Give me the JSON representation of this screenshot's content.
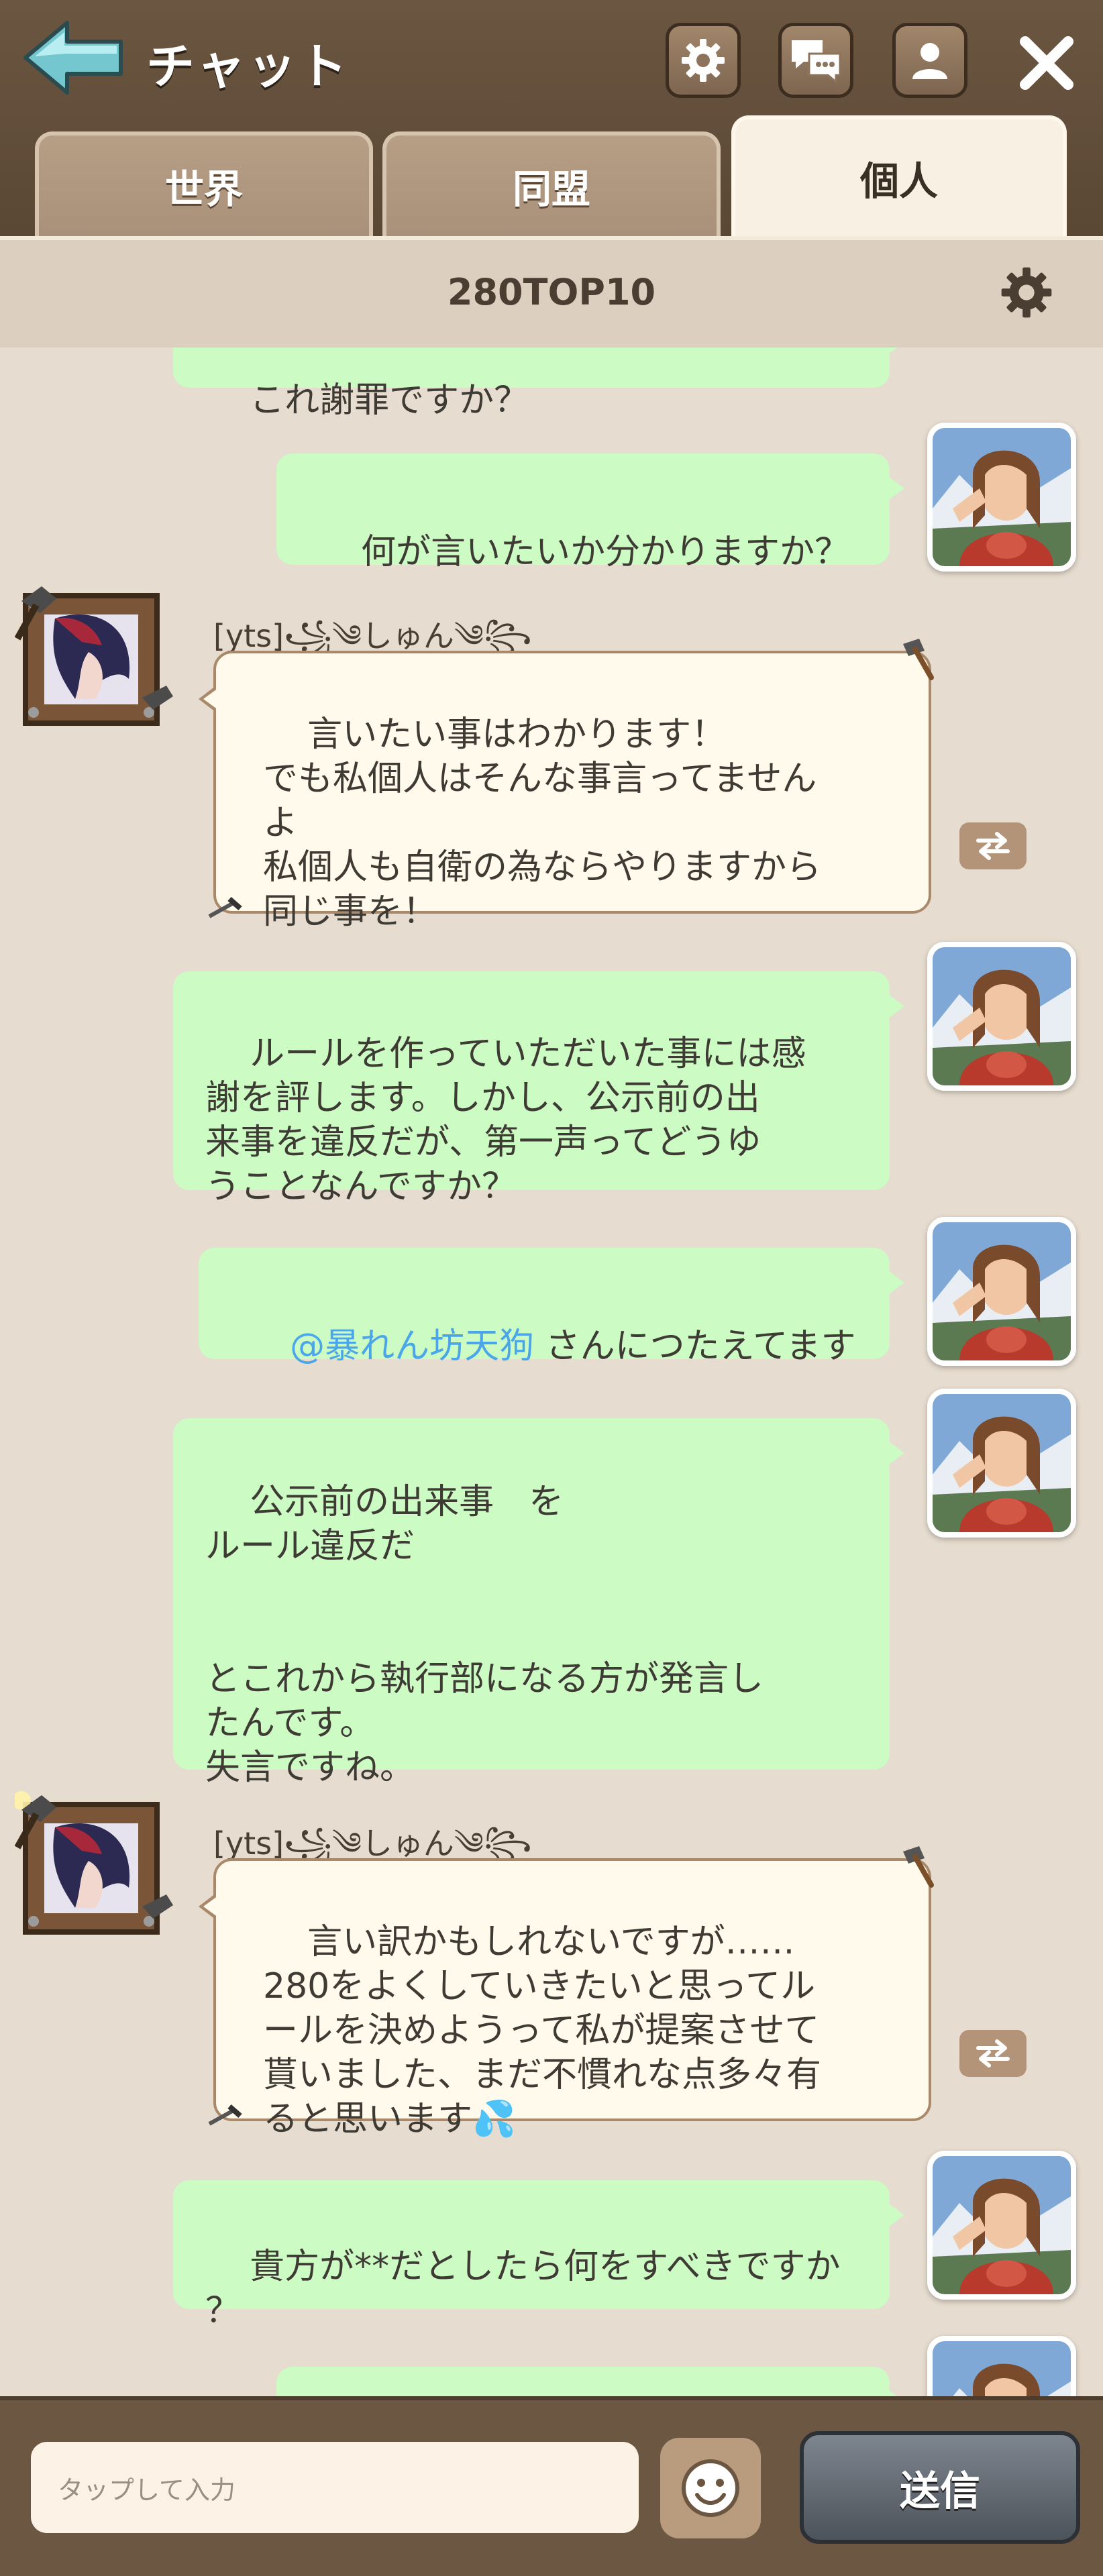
{
  "header": {
    "title": "チャット",
    "back_icon": "back-arrow-icon",
    "icons": [
      "gear-icon",
      "chat-bubbles-icon",
      "profile-icon",
      "close-icon"
    ]
  },
  "tabs": [
    {
      "label": "世界",
      "active": false
    },
    {
      "label": "同盟",
      "active": false
    },
    {
      "label": "個人",
      "active": true
    }
  ],
  "room": {
    "name": "280TOP10"
  },
  "messages": {
    "m0": "これ謝罪ですか？",
    "m1": "何が言いたいか分かりますか？",
    "m2_sender": "[yts]꧁༄しゅん༄꧂",
    "m2": "言いたい事はわかります！\nでも私個人はそんな事言ってません\nよ\n私個人も自衛の為ならやりますから\n同じ事を！",
    "m3": "ルールを作っていただいた事には感\n謝を評します。しかし、公示前の出\n来事を違反だが、第一声ってどうゆ\nうことなんですか？",
    "m4_mention": "@暴れん坊天狗",
    "m4_text": " さんにつたえてます",
    "m5": "公示前の出来事　を\nルール違反だ\n\n\nとこれから執行部になる方が発言し\nたんです。\n失言ですね。",
    "m6_sender": "[yts]꧁༄しゅん༄꧂",
    "m6": "言い訳かもしれないですが……\n280をよくしていきたいと思ってル\nールを決めようって私が提案させて\n貰いました、まだ不慣れな点多々有\nると思います💦",
    "m7": "貴方が**だとしたら何をすべきですか\n？"
  },
  "input": {
    "placeholder": "タップして入力",
    "value": ""
  },
  "send_label": "送信",
  "colors": {
    "header_bg": "#5a4734",
    "my_bubble": "#ccfbc4",
    "other_bubble": "#fffaec",
    "mention": "#4aa6e8",
    "send_button": "#4d535a"
  }
}
